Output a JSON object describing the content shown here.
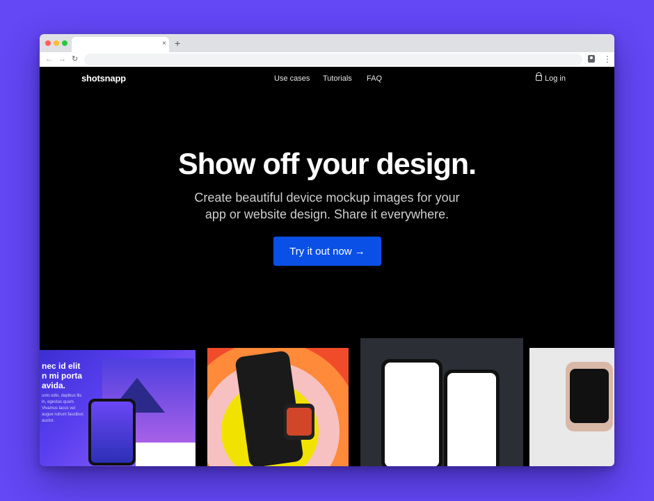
{
  "browser": {
    "tab_close": "×",
    "new_tab": "+",
    "back": "←",
    "forward": "→",
    "reload": "↻",
    "menu": "⋮"
  },
  "header": {
    "logo": "shotsnapp",
    "nav": [
      "Use cases",
      "Tutorials",
      "FAQ"
    ],
    "login": "Log in"
  },
  "hero": {
    "title": "Show off your design.",
    "subtitle_line1": "Create beautiful device mockup images for your",
    "subtitle_line2": "app or website design. Share it everywhere.",
    "cta": "Try it out now →"
  },
  "gallery": {
    "tile1_text": [
      "nec id elit",
      "n mi porta",
      "avida."
    ],
    "tile1_paragraph": "usto odio, dapibus llis in, egestas quam. Vivamus lacus vel augue rutrum faucibus auctor."
  },
  "colors": {
    "background": "#6447f5",
    "page": "#000000",
    "cta": "#0a50e6"
  }
}
